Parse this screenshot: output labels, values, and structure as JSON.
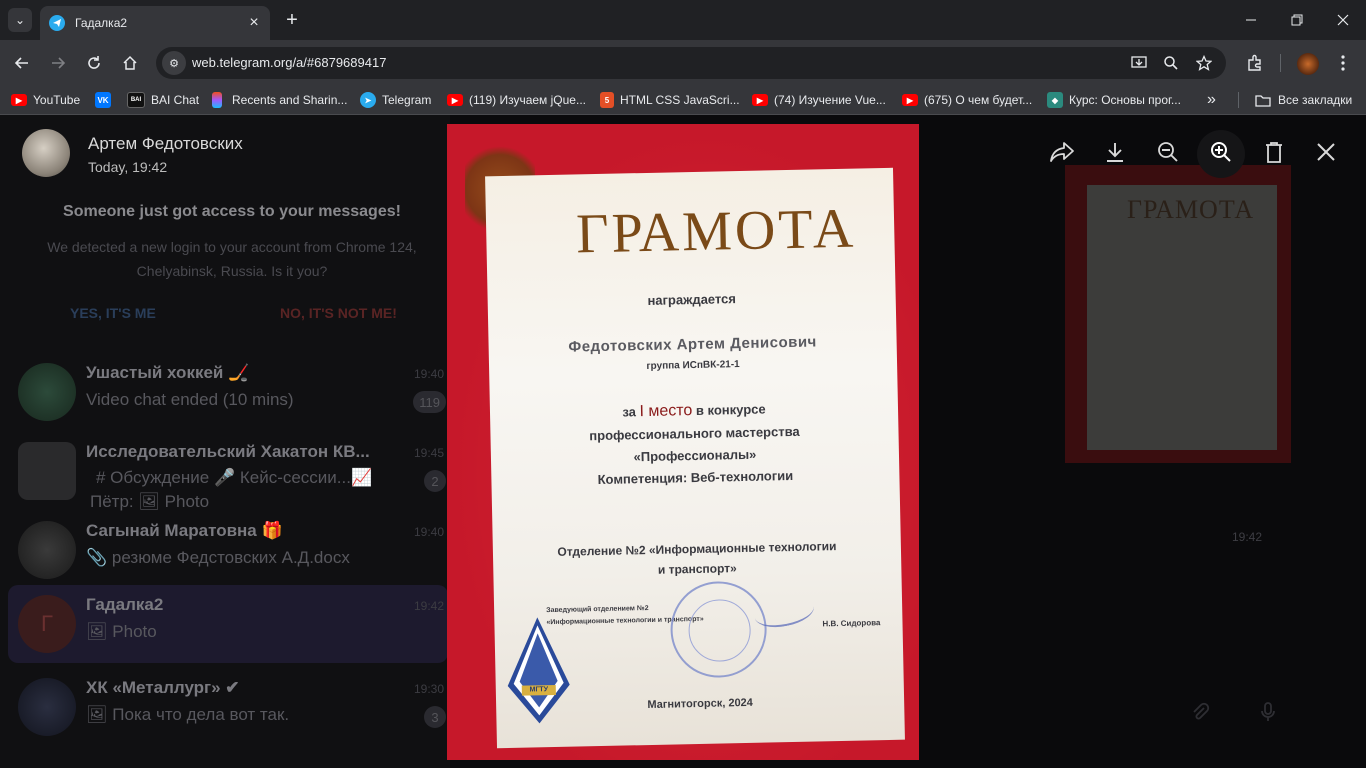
{
  "browser": {
    "tab_title": "Гадалка2",
    "url": "web.telegram.org/a/#6879689417",
    "bookmarks": [
      {
        "label": "YouTube",
        "icon": "youtube-icon"
      },
      {
        "label": "",
        "icon": "vk-icon"
      },
      {
        "label": "BAI Chat",
        "icon": "bai-icon"
      },
      {
        "label": "Recents and Sharin...",
        "icon": "figma-icon"
      },
      {
        "label": "Telegram",
        "icon": "telegram-icon"
      },
      {
        "label": "(119) Изучаем jQue...",
        "icon": "youtube-icon"
      },
      {
        "label": "HTML CSS JavaScri...",
        "icon": "html5-icon"
      },
      {
        "label": "(74) Изучение Vue...",
        "icon": "youtube-icon"
      },
      {
        "label": "(675) О чем будет...",
        "icon": "youtube-icon"
      },
      {
        "label": "Курс: Основы прог...",
        "icon": "course-icon"
      }
    ],
    "all_bookmarks": "Все закладки",
    "more_glyph": "»"
  },
  "viewer": {
    "sender_name": "Артем Федотовских",
    "sent_time": "Today, 19:42"
  },
  "certificate": {
    "title": "ГРАМОТА",
    "awarded": "награждается",
    "recipient": "Федотовских Артем Денисович",
    "group": "группа ИСпВК-21-1",
    "place_prefix": "за",
    "place": "I место",
    "place_suffix": "в конкурсе",
    "line2": "профессионального мастерства",
    "line3": "«Профессионалы»",
    "line4": "Компетенция: Веб-технологии",
    "dept1": "Отделение №2 «Информационные технологии",
    "dept2": "и транспорт»",
    "head1": "Заведующий отделением №2",
    "head2": "«Информационные технологии и транспорт»",
    "signer": "Н.В. Сидорова",
    "city_year": "Магнитогорск, 2024",
    "logo_text": "МГТУ"
  },
  "notice": {
    "title": "Someone just got access to your messages!",
    "body": "We detected a new login to your account from Chrome 124, Chelyabinsk, Russia. Is it you?",
    "yes": "YES, IT'S ME",
    "no": "NO, IT'S NOT ME!"
  },
  "chats": [
    {
      "name": "Ушастый хоккей 🏒",
      "message": "Video chat ended (10 mins)",
      "time": "19:40",
      "badge": "119"
    },
    {
      "name": "Исследовательский Хакатон КВ...",
      "message": "# Обсуждение  🎤 Кейс-сессии...📈",
      "message2": "Пётр: 🖼 Photo",
      "time": "19:45",
      "badge": "2"
    },
    {
      "name": "Сагынай Маратовна 🎁",
      "message": "📎 резюме Федстовских А.Д.docx",
      "time": "19:40",
      "badge": ""
    },
    {
      "name": "Гадалка2",
      "message": "🖼 Photo",
      "time": "19:42",
      "badge": "",
      "avatar_letter": "Г"
    },
    {
      "name": "ХК «Металлург» ✔",
      "message": "🖼 Пока что дела вот так.",
      "time": "19:30",
      "badge": "3"
    }
  ],
  "thumbnail": {
    "title": "ГРАМОТА",
    "time": "19:42"
  },
  "colors": {
    "accent": "#2aabee",
    "photo_border": "#c6182a",
    "paper": "#f6f3ee",
    "title_brown": "#7a4a18"
  }
}
